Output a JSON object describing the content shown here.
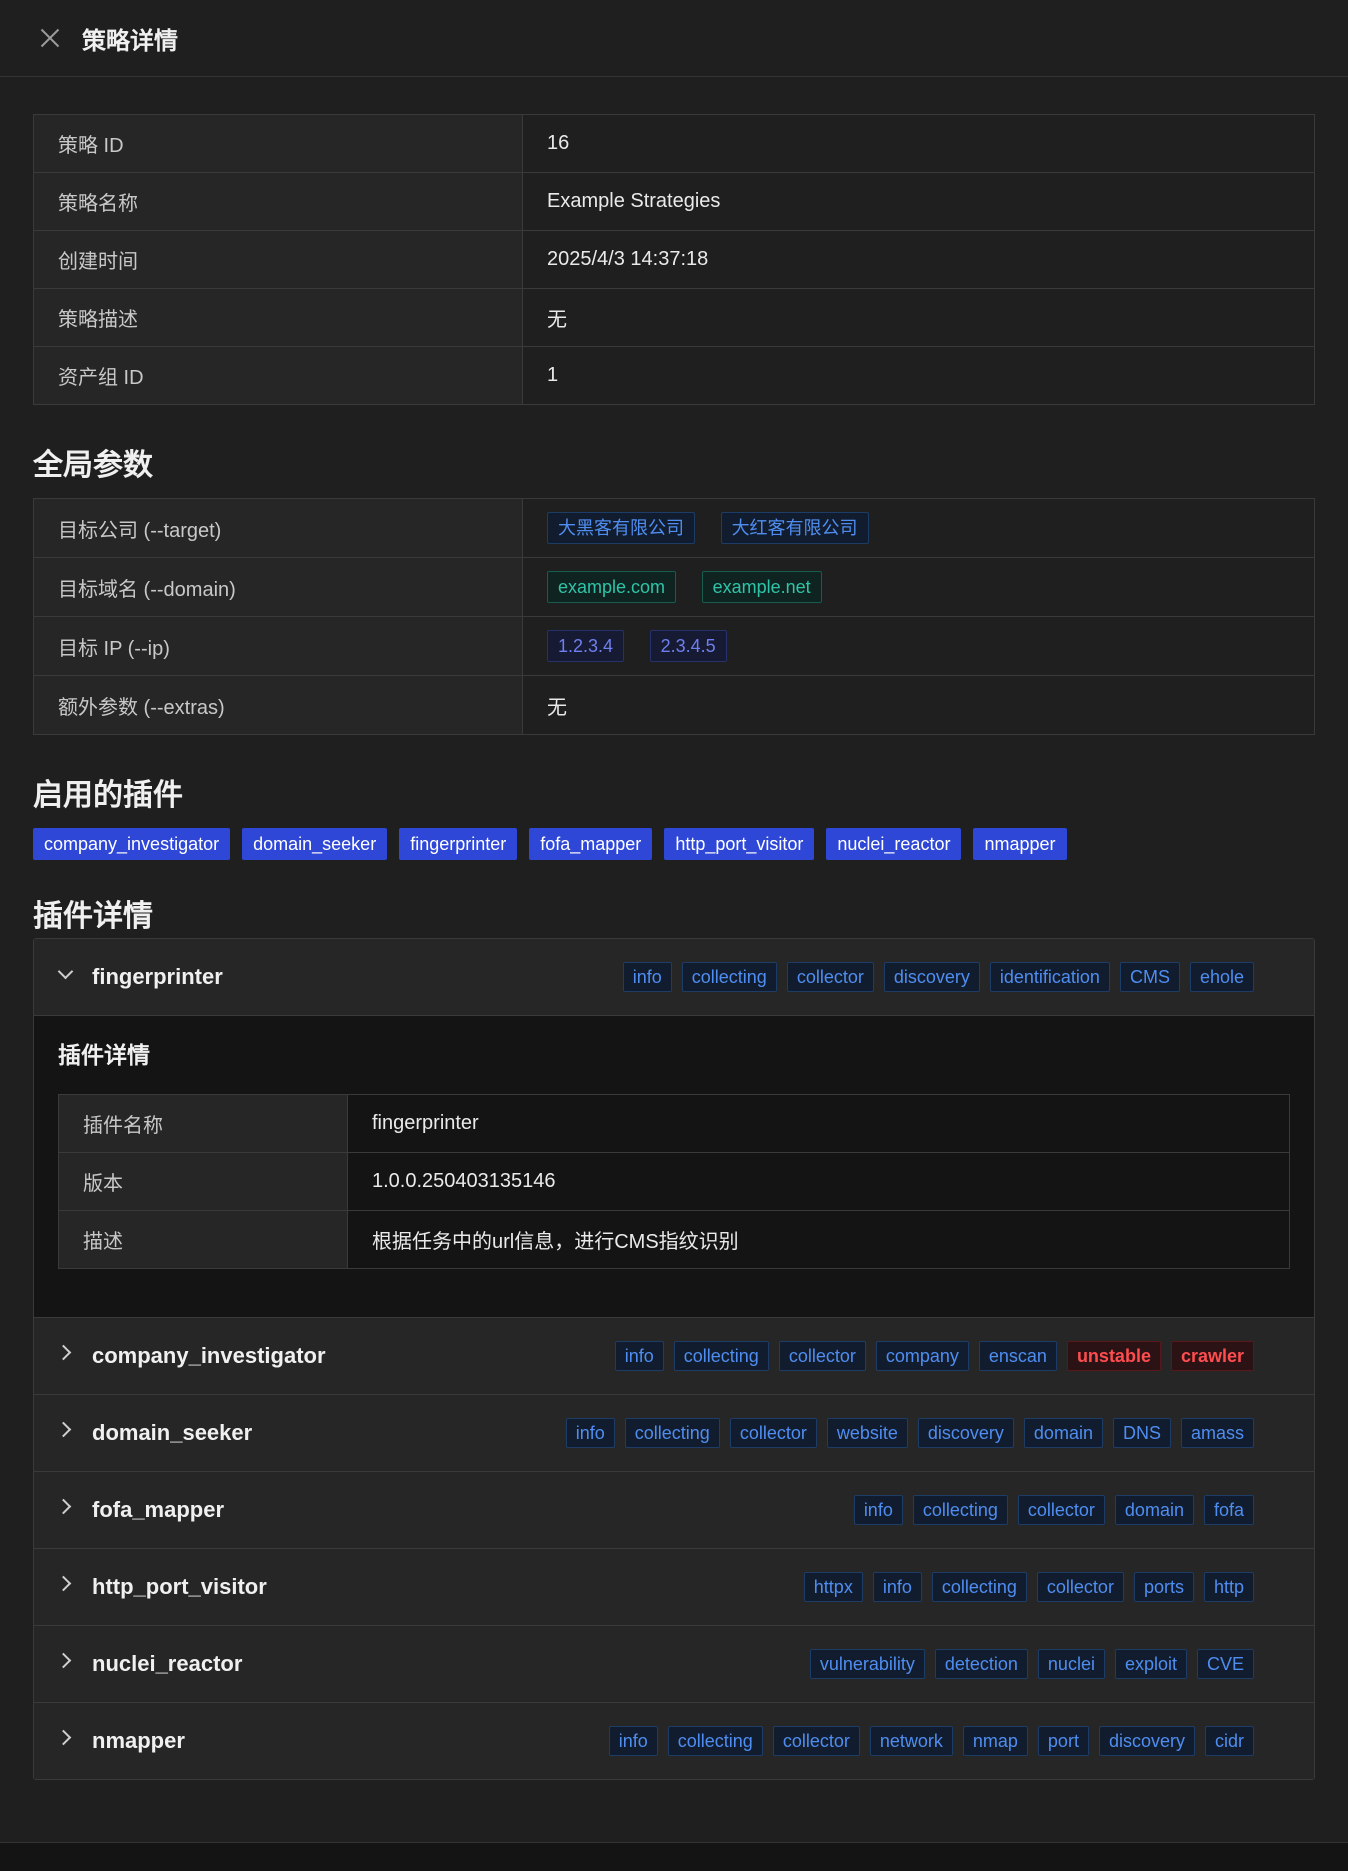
{
  "header": {
    "title": "策略详情"
  },
  "strategy": [
    {
      "label": "策略 ID",
      "value": "16"
    },
    {
      "label": "策略名称",
      "value": "Example Strategies"
    },
    {
      "label": "创建时间",
      "value": "2025/4/3 14:37:18"
    },
    {
      "label": "策略描述",
      "value": "无"
    },
    {
      "label": "资产组 ID",
      "value": "1"
    }
  ],
  "global_params": {
    "title": "全局参数",
    "target_label": "目标公司 (--target)",
    "targets": [
      "大黑客有限公司",
      "大红客有限公司"
    ],
    "domain_label": "目标域名 (--domain)",
    "domains": [
      "example.com",
      "example.net"
    ],
    "ip_label": "目标 IP (--ip)",
    "ips": [
      "1.2.3.4",
      "2.3.4.5"
    ],
    "extras_label": "额外参数 (--extras)",
    "extras_value": "无"
  },
  "enabled_plugins": {
    "title": "启用的插件",
    "items": [
      "company_investigator",
      "domain_seeker",
      "fingerprinter",
      "fofa_mapper",
      "http_port_visitor",
      "nuclei_reactor",
      "nmapper"
    ]
  },
  "plugin_details": {
    "title": "插件详情",
    "panels": [
      {
        "name": "fingerprinter",
        "tags": [
          "info",
          "collecting",
          "collector",
          "discovery",
          "identification",
          "CMS",
          "ehole"
        ],
        "expanded": true,
        "body": {
          "title": "插件详情",
          "rows": [
            {
              "label": "插件名称",
              "value": "fingerprinter"
            },
            {
              "label": "版本",
              "value": "1.0.0.250403135146"
            },
            {
              "label": "描述",
              "value": "根据任务中的url信息，进行CMS指纹识别"
            }
          ]
        }
      },
      {
        "name": "company_investigator",
        "tags": [
          "info",
          "collecting",
          "collector",
          "company",
          "enscan",
          "unstable",
          "crawler"
        ]
      },
      {
        "name": "domain_seeker",
        "tags": [
          "info",
          "collecting",
          "collector",
          "website",
          "discovery",
          "domain",
          "DNS",
          "amass"
        ]
      },
      {
        "name": "fofa_mapper",
        "tags": [
          "info",
          "collecting",
          "collector",
          "domain",
          "fofa"
        ]
      },
      {
        "name": "http_port_visitor",
        "tags": [
          "httpx",
          "info",
          "collecting",
          "collector",
          "ports",
          "http"
        ]
      },
      {
        "name": "nuclei_reactor",
        "tags": [
          "vulnerability",
          "detection",
          "nuclei",
          "exploit",
          "CVE"
        ]
      },
      {
        "name": "nmapper",
        "tags": [
          "info",
          "collecting",
          "collector",
          "network",
          "nmap",
          "port",
          "discovery",
          "cidr"
        ]
      }
    ]
  }
}
